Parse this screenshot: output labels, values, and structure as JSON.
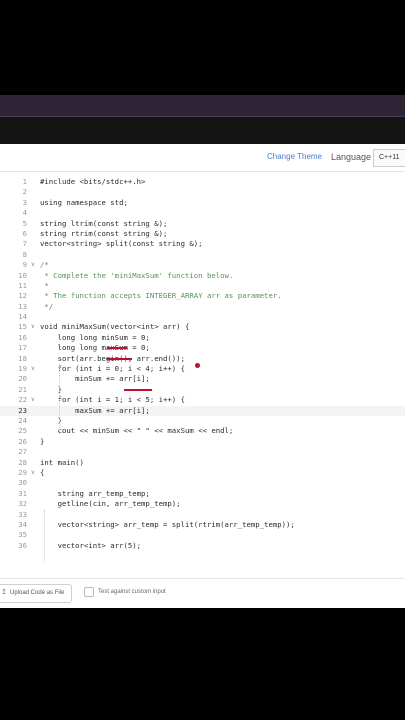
{
  "toolbar": {
    "change_theme": "Change Theme",
    "language_label": "Language",
    "language_value": "C++11"
  },
  "code_lines": [
    {
      "n": "1",
      "t": "#include <bits/stdc++.h>"
    },
    {
      "n": "2",
      "t": ""
    },
    {
      "n": "3",
      "t": "using namespace std;"
    },
    {
      "n": "4",
      "t": ""
    },
    {
      "n": "5",
      "t": "string ltrim(const string &);"
    },
    {
      "n": "6",
      "t": "string rtrim(const string &);"
    },
    {
      "n": "7",
      "t": "vector<string> split(const string &);"
    },
    {
      "n": "8",
      "t": ""
    },
    {
      "n": "9",
      "t": "/*"
    },
    {
      "n": "10",
      "t": " * Complete the 'miniMaxSum' function below."
    },
    {
      "n": "11",
      "t": " *"
    },
    {
      "n": "12",
      "t": " * The function accepts INTEGER_ARRAY arr as parameter."
    },
    {
      "n": "13",
      "t": " */"
    },
    {
      "n": "14",
      "t": ""
    },
    {
      "n": "15",
      "t": "void miniMaxSum(vector<int> arr) {"
    },
    {
      "n": "16",
      "t": "    long long minSum = 0;"
    },
    {
      "n": "17",
      "t": "    long long maxSum = 0;"
    },
    {
      "n": "18",
      "t": "    sort(arr.begin(), arr.end());"
    },
    {
      "n": "19",
      "t": "    for (int i = 0; i < 4; i++) {"
    },
    {
      "n": "20",
      "t": "        minSum += arr[i];"
    },
    {
      "n": "21",
      "t": "    }"
    },
    {
      "n": "22",
      "t": "    for (int i = 1; i < 5; i++) {"
    },
    {
      "n": "23",
      "t": "        maxSum += arr[i];"
    },
    {
      "n": "24",
      "t": "    }"
    },
    {
      "n": "25",
      "t": "    cout << minSum << \" \" << maxSum << endl;"
    },
    {
      "n": "26",
      "t": "}"
    },
    {
      "n": "27",
      "t": ""
    },
    {
      "n": "28",
      "t": "int main()"
    },
    {
      "n": "29",
      "t": "{"
    },
    {
      "n": "30",
      "t": ""
    },
    {
      "n": "31",
      "t": "    string arr_temp_temp;"
    },
    {
      "n": "32",
      "t": "    getline(cin, arr_temp_temp);"
    },
    {
      "n": "33",
      "t": ""
    },
    {
      "n": "34",
      "t": "    vector<string> arr_temp = split(rtrim(arr_temp_temp));"
    },
    {
      "n": "35",
      "t": ""
    },
    {
      "n": "36",
      "t": "    vector<int> arr(5);"
    }
  ],
  "footer": {
    "upload_label": "Upload Code as File",
    "custom_input_label": "Test against custom input"
  },
  "colors": {
    "annotation": "#c0102a",
    "link": "#4a7bc8",
    "comment": "#5a8f5a"
  }
}
